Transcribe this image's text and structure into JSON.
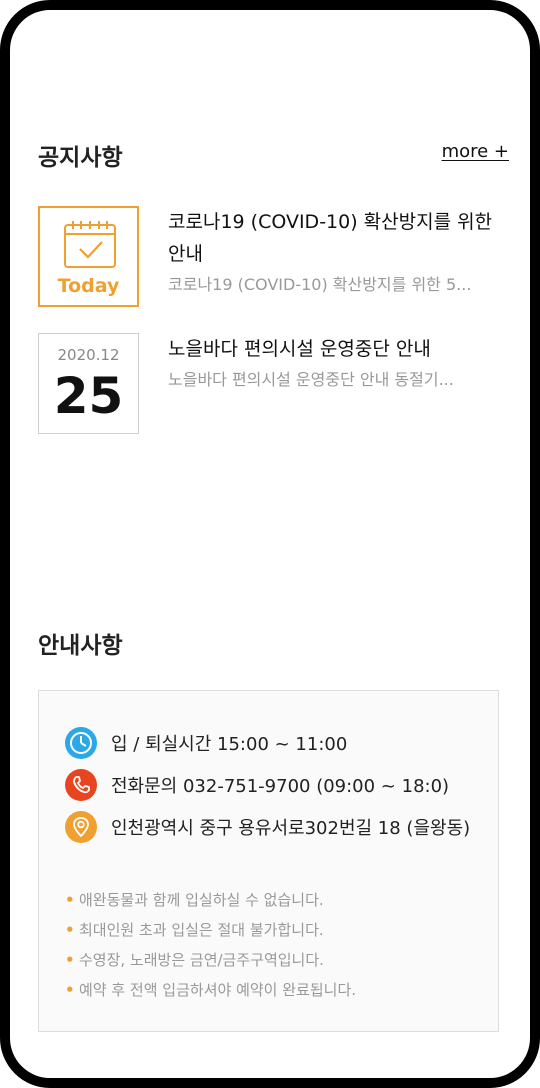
{
  "notice": {
    "title": "공지사항",
    "more_label": "more +",
    "items": [
      {
        "badge_label": "Today",
        "heading": "코로나19 (COVID-10) 확산방지를 위한 안내",
        "preview": "코로나19 (COVID-10) 확산방지를 위한 5..."
      },
      {
        "date_month": "2020.12",
        "date_day": "25",
        "heading": "노을바다 편의시설 운영중단 안내",
        "preview": "노을바다 편의시설 운영중단 안내 동절기..."
      }
    ]
  },
  "info": {
    "title": "안내사항",
    "rows": [
      {
        "icon": "clock-icon",
        "color": "#2aa8e8",
        "text": "입 / 퇴실시간 15:00 ~ 11:00"
      },
      {
        "icon": "phone-icon",
        "color": "#e84420",
        "text": "전화문의 032-751-9700 (09:00 ~ 18:0)"
      },
      {
        "icon": "location-pin-icon",
        "color": "#f0a030",
        "text": "인천광역시 중구 용유서로302번길 18 (을왕동)"
      }
    ],
    "rules": [
      "애완동물과 함께 입실하실 수 없습니다.",
      "최대인원 초과 입실은 절대 불가합니다.",
      "수영장, 노래방은 금연/금주구역입니다.",
      "예약 후 전액 입금하셔야 예약이 완료됩니다."
    ],
    "bullet_color": "#f0a030"
  }
}
